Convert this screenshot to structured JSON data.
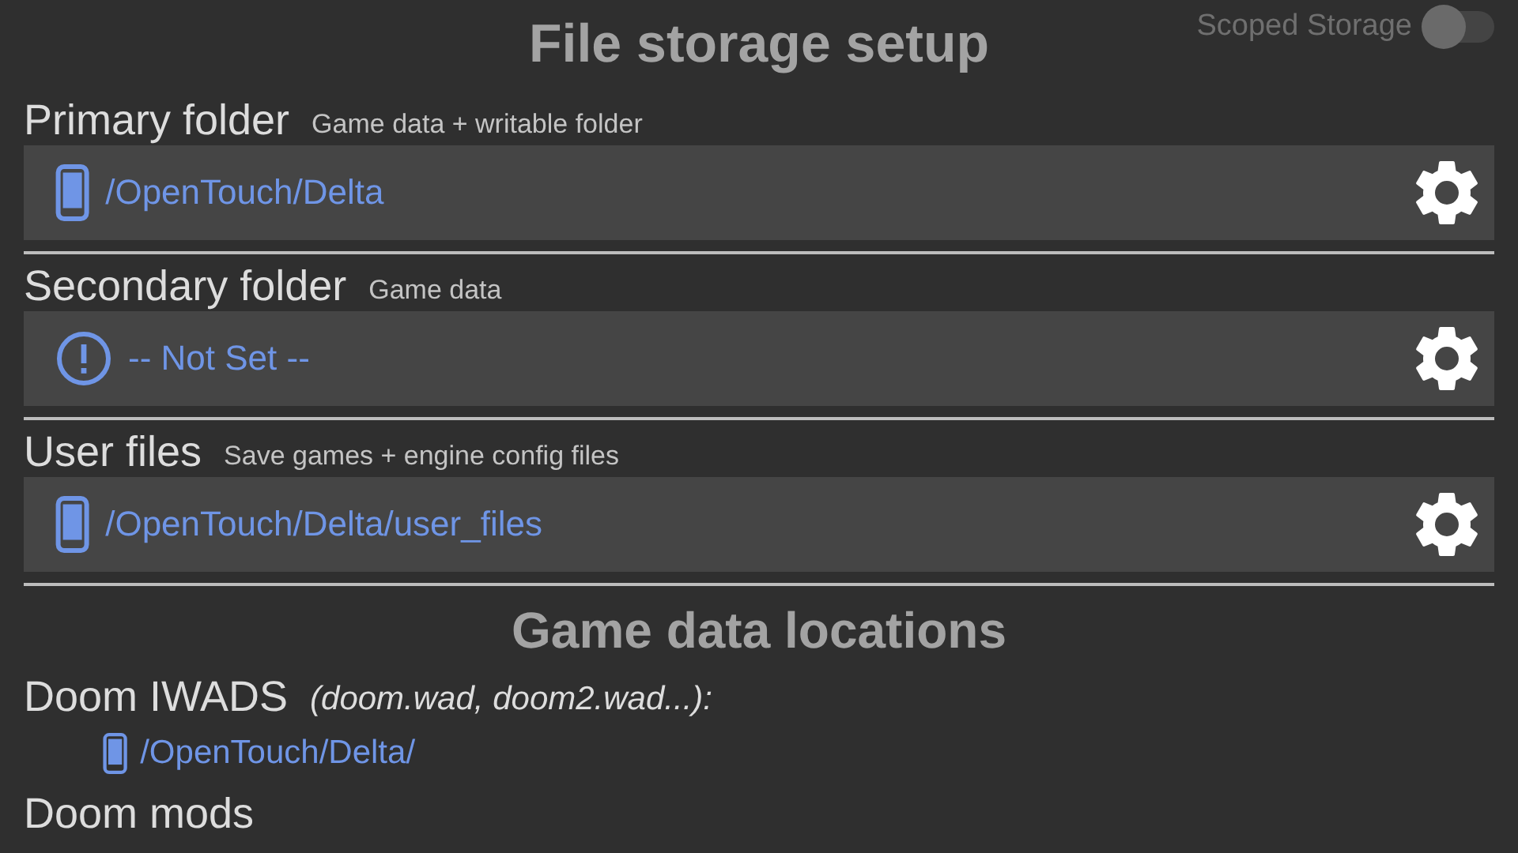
{
  "title": "File storage setup",
  "scoped_storage": {
    "label": "Scoped Storage",
    "on": false
  },
  "folders": [
    {
      "label": "Primary folder",
      "hint": "Game data + writable folder",
      "path": "/OpenTouch/Delta",
      "kind": "phone"
    },
    {
      "label": "Secondary folder",
      "hint": "Game data",
      "path": "-- Not Set --",
      "kind": "warning"
    },
    {
      "label": "User files",
      "hint": "Save games + engine config files",
      "path": "/OpenTouch/Delta/user_files",
      "kind": "phone"
    }
  ],
  "locations_heading": "Game data locations",
  "locations": [
    {
      "label": "Doom IWADS",
      "hint": "(doom.wad, doom2.wad...):",
      "path": "/OpenTouch/Delta/"
    },
    {
      "label": "Doom mods"
    }
  ]
}
